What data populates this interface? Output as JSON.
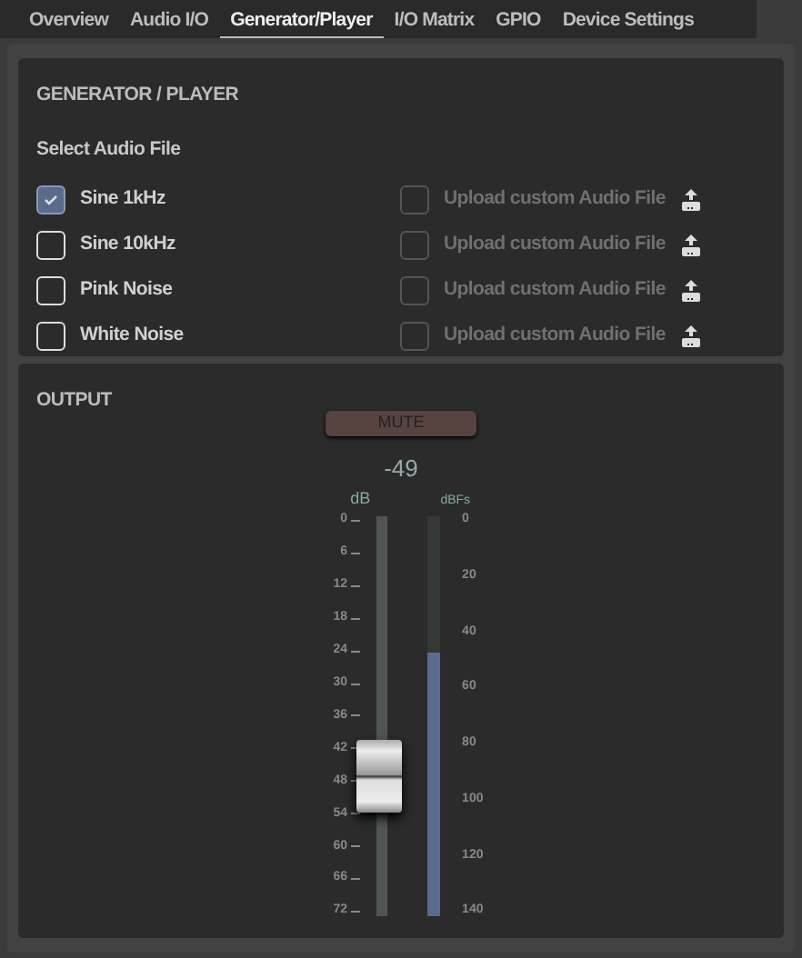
{
  "tabs": [
    {
      "label": "Overview",
      "selected": false
    },
    {
      "label": "Audio I/O",
      "selected": false
    },
    {
      "label": "Generator/Player",
      "selected": true
    },
    {
      "label": "I/O Matrix",
      "selected": false
    },
    {
      "label": "GPIO",
      "selected": false
    },
    {
      "label": "Device Settings",
      "selected": false
    }
  ],
  "generator": {
    "title": "GENERATOR / PLAYER",
    "subtitle": "Select Audio File",
    "sources": [
      {
        "label": "Sine 1kHz",
        "checked": true,
        "upload_label": "Upload custom Audio File",
        "upload_checked": false
      },
      {
        "label": "Sine 10kHz",
        "checked": false,
        "upload_label": "Upload custom Audio File",
        "upload_checked": false
      },
      {
        "label": "Pink Noise",
        "checked": false,
        "upload_label": "Upload custom Audio File",
        "upload_checked": false
      },
      {
        "label": "White Noise",
        "checked": false,
        "upload_label": "Upload custom Audio File",
        "upload_checked": false
      }
    ]
  },
  "output": {
    "title": "OUTPUT",
    "mute": {
      "label": "MUTE",
      "on": false
    },
    "gain_reading": "-49",
    "fader_unit": "dB",
    "meter_unit": "dBFs",
    "fader": {
      "level": 0.35
    },
    "meter": {
      "level": 0.66
    },
    "fader_scale": [
      "0",
      "6",
      "12",
      "18",
      "24",
      "30",
      "36",
      "42",
      "48",
      "54",
      "60",
      "66",
      "72"
    ],
    "meter_scale": [
      "0",
      "20",
      "40",
      "60",
      "80",
      "100",
      "120",
      "140"
    ]
  }
}
